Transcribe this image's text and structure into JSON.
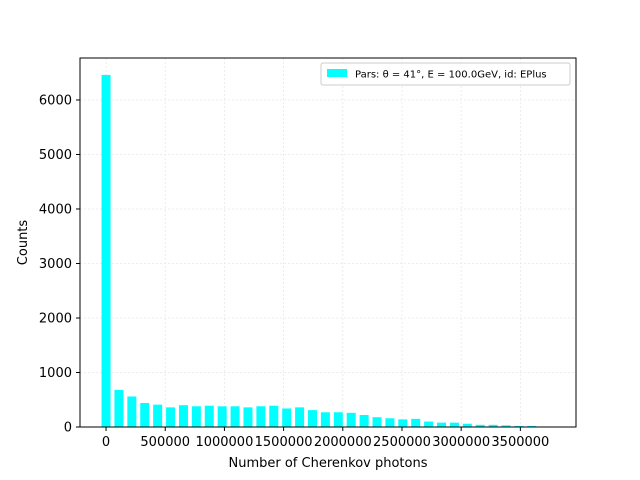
{
  "chart_data": {
    "type": "bar",
    "xlabel": "Number of Cherenkov photons",
    "ylabel": "Counts",
    "legend": {
      "label": "Pars: θ = 41°, E = 100.0GeV, id: EPlus",
      "location": "top-right"
    },
    "grid": true,
    "bar_color": "#00ffff",
    "xlim": [
      -220000,
      3970000
    ],
    "ylim": [
      0,
      6770
    ],
    "xticks": [
      0,
      500000,
      1000000,
      1500000,
      2000000,
      2500000,
      3000000,
      3500000
    ],
    "xtick_labels": [
      "0",
      "500000",
      "1000000",
      "1500000",
      "2000000",
      "2500000",
      "3000000",
      "3500000"
    ],
    "yticks": [
      0,
      1000,
      2000,
      3000,
      4000,
      5000,
      6000
    ],
    "ytick_labels": [
      "0",
      "1000",
      "2000",
      "3000",
      "4000",
      "5000",
      "6000"
    ],
    "bin_width": 76000,
    "x": [
      0,
      109000,
      218000,
      327000,
      436000,
      545000,
      654000,
      763000,
      872000,
      981000,
      1090000,
      1199000,
      1308000,
      1417000,
      1526000,
      1635000,
      1744000,
      1853000,
      1962000,
      2071000,
      2180000,
      2289000,
      2398000,
      2507000,
      2616000,
      2725000,
      2834000,
      2943000,
      3052000,
      3161000,
      3270000,
      3379000,
      3488000,
      3597000,
      3706000
    ],
    "values": [
      6460,
      680,
      560,
      440,
      410,
      360,
      400,
      380,
      390,
      380,
      380,
      360,
      380,
      390,
      340,
      360,
      310,
      270,
      270,
      260,
      220,
      180,
      160,
      140,
      150,
      100,
      80,
      80,
      60,
      40,
      40,
      30,
      20,
      20,
      10
    ]
  }
}
